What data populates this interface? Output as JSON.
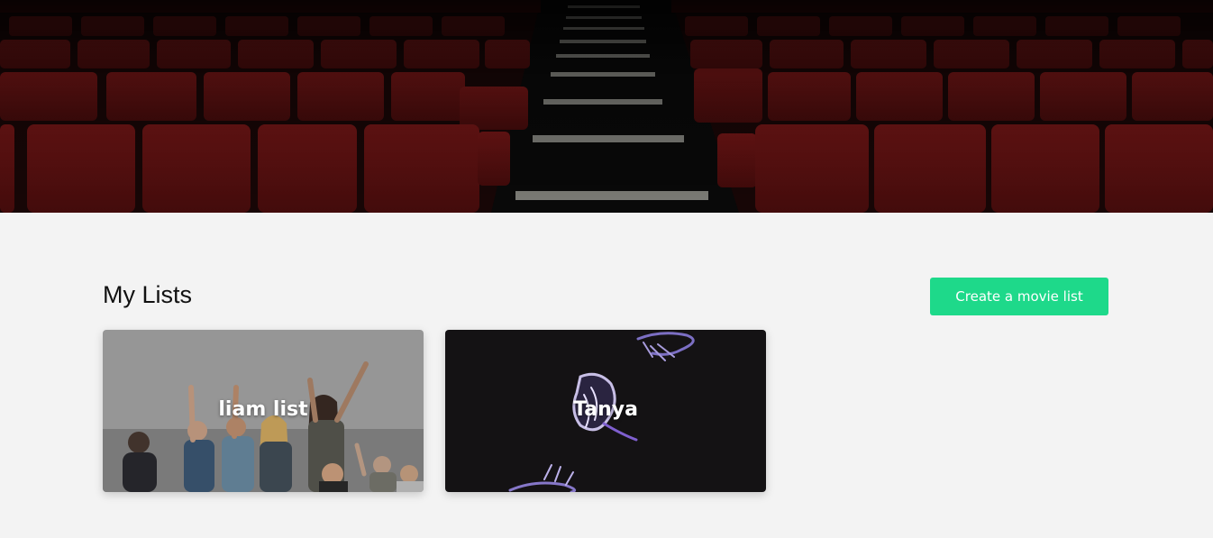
{
  "hero": {
    "image": "theater-seats-aisle"
  },
  "section": {
    "title": "My Lists",
    "create_button_label": "Create a movie list"
  },
  "lists": [
    {
      "name": "liam list",
      "image": "festival-crowd"
    },
    {
      "name": "Tanya",
      "image": "glowing-jellyfish"
    }
  ],
  "colors": {
    "accent": "#1ed98a",
    "background": "#f3f3f3",
    "seat_red": "#6b1414"
  }
}
